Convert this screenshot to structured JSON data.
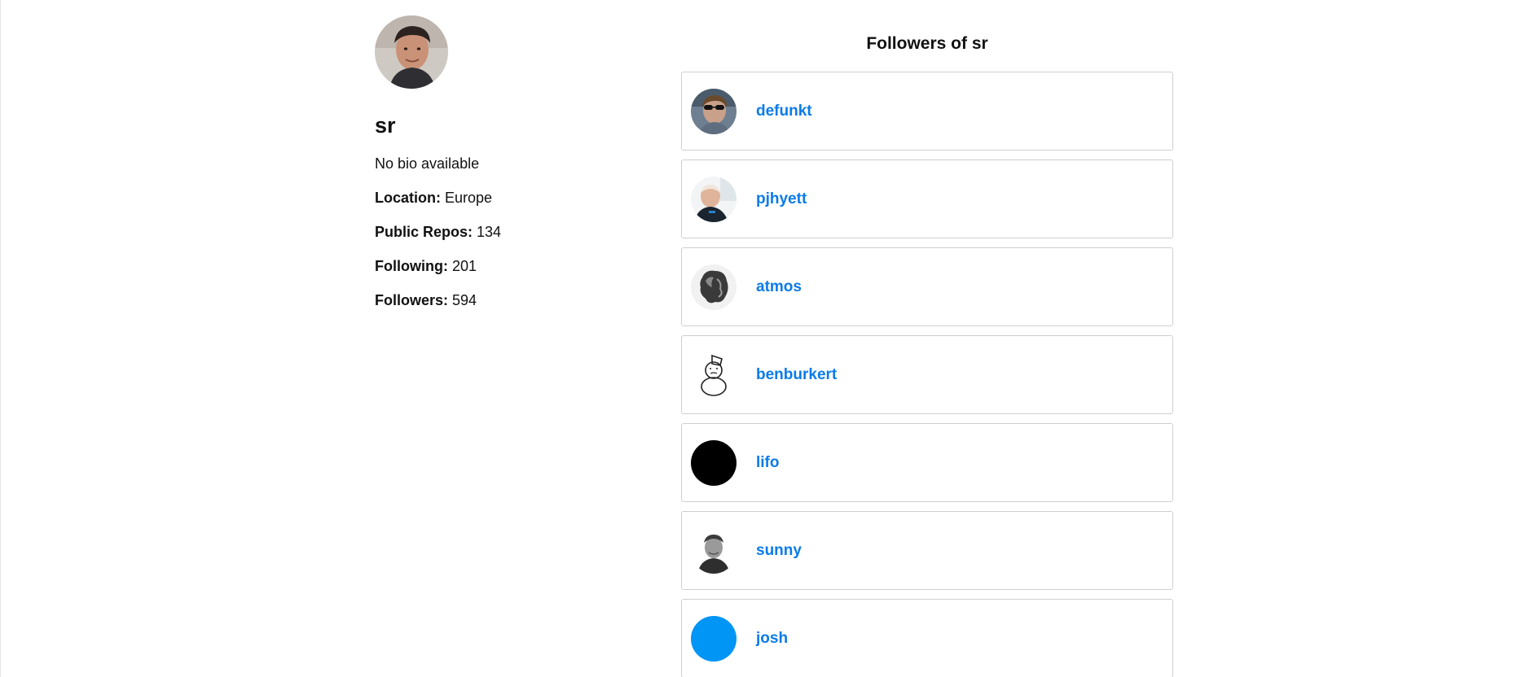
{
  "profile": {
    "name": "sr",
    "bio": "No bio available",
    "location_label": "Location:",
    "location": "Europe",
    "repos_label": "Public Repos:",
    "repos": "134",
    "following_label": "Following:",
    "following": "201",
    "followers_label": "Followers:",
    "followers": "594"
  },
  "followers_section": {
    "title": "Followers of sr",
    "items": [
      {
        "username": "defunkt"
      },
      {
        "username": "pjhyett"
      },
      {
        "username": "atmos"
      },
      {
        "username": "benburkert"
      },
      {
        "username": "lifo"
      },
      {
        "username": "sunny"
      },
      {
        "username": "josh"
      }
    ]
  },
  "colors": {
    "link": "#0a7bea",
    "card_border": "#cfcfcf",
    "josh_avatar": "#0195f6",
    "lifo_avatar": "#000000"
  }
}
